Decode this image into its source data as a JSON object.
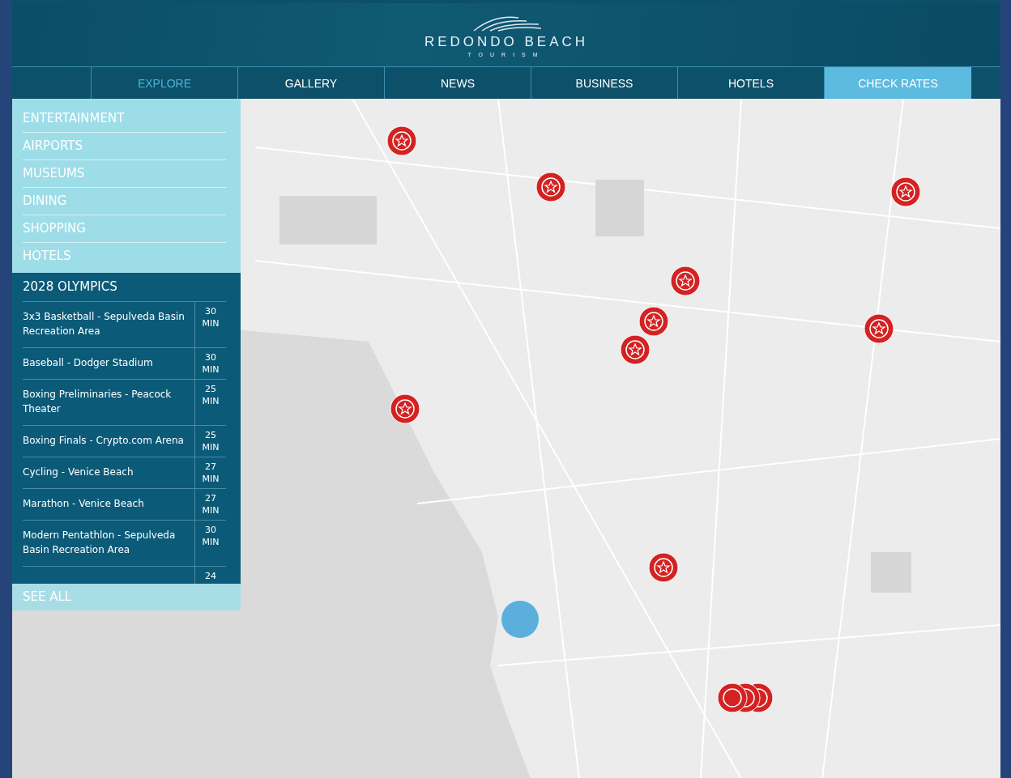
{
  "header": {
    "logo_title": "REDONDO BEACH",
    "logo_subtitle": "TOURISM"
  },
  "nav": [
    {
      "label": "EXPLORE",
      "selected": true
    },
    {
      "label": "GALLERY",
      "selected": false
    },
    {
      "label": "NEWS",
      "selected": false
    },
    {
      "label": "BUSINESS",
      "selected": false
    },
    {
      "label": "HOTELS",
      "selected": false
    }
  ],
  "cta": "CHECK RATES",
  "categories": [
    "ENTERTAINMENT",
    "AIRPORTS",
    "MUSEUMS",
    "DINING",
    "SHOPPING",
    "HOTELS"
  ],
  "olympics": {
    "title": "2028 OLYMPICS",
    "venues": [
      {
        "name": "3x3 Basketball - Sepulveda Basin Recreation Area",
        "time": "30",
        "unit": "MIN"
      },
      {
        "name": "Baseball - Dodger Stadium",
        "time": "30",
        "unit": "MIN"
      },
      {
        "name": "Boxing Preliminaries - Peacock Theater",
        "time": "25",
        "unit": "MIN"
      },
      {
        "name": "Boxing Finals - Crypto.com Arena",
        "time": "25",
        "unit": "MIN"
      },
      {
        "name": "Cycling - Venice Beach",
        "time": "27",
        "unit": "MIN"
      },
      {
        "name": "Marathon - Venice Beach",
        "time": "27",
        "unit": "MIN"
      },
      {
        "name": "Modern Pentathlon - Sepulveda Basin Recreation Area",
        "time": "30",
        "unit": "MIN"
      },
      {
        "time": "24"
      }
    ],
    "see_all": "SEE ALL"
  }
}
